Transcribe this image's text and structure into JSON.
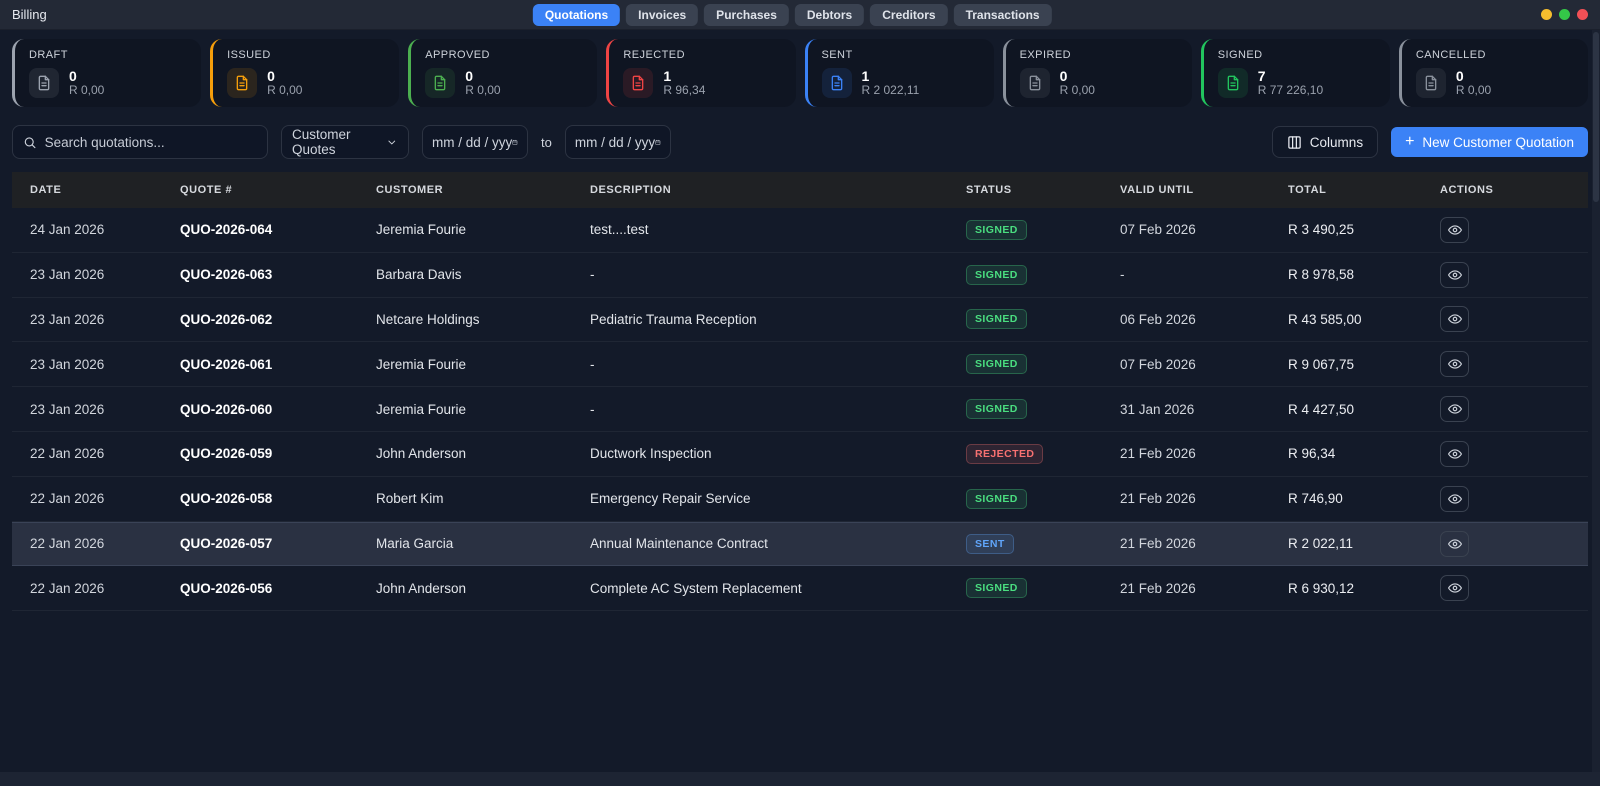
{
  "app": {
    "title": "Billing",
    "window_buttons": [
      {
        "name": "window-button-minimize",
        "color": "#f5bd2e"
      },
      {
        "name": "window-button-maximize",
        "color": "#34c748"
      },
      {
        "name": "window-button-close",
        "color": "#f25056"
      }
    ]
  },
  "colors": {
    "accent": "#3b82f6",
    "status": {
      "SIGNED": "#4ade80",
      "REJECTED": "#f87171",
      "SENT": "#60a5fa"
    }
  },
  "tabs": [
    {
      "label": "Quotations",
      "active": true
    },
    {
      "label": "Invoices",
      "active": false
    },
    {
      "label": "Purchases",
      "active": false
    },
    {
      "label": "Debtors",
      "active": false
    },
    {
      "label": "Creditors",
      "active": false
    },
    {
      "label": "Transactions",
      "active": false
    }
  ],
  "summary_cards": [
    {
      "label": "DRAFT",
      "count": "0",
      "amount": "R 0,00",
      "color": "#9ca3af"
    },
    {
      "label": "ISSUED",
      "count": "0",
      "amount": "R 0,00",
      "color": "#f59e0b"
    },
    {
      "label": "APPROVED",
      "count": "0",
      "amount": "R 0,00",
      "color": "#4caf50"
    },
    {
      "label": "REJECTED",
      "count": "1",
      "amount": "R 96,34",
      "color": "#ef4444"
    },
    {
      "label": "SENT",
      "count": "1",
      "amount": "R 2 022,11",
      "color": "#3b82f6"
    },
    {
      "label": "EXPIRED",
      "count": "0",
      "amount": "R 0,00",
      "color": "#8a919c"
    },
    {
      "label": "SIGNED",
      "count": "7",
      "amount": "R 77 226,10",
      "color": "#22c55e"
    },
    {
      "label": "CANCELLED",
      "count": "0",
      "amount": "R 0,00",
      "color": "#8a919c"
    }
  ],
  "filters": {
    "search_placeholder": "Search quotations...",
    "type_select_value": "Customer Quotes",
    "date_from_value": "mm / dd / yyy",
    "to_label": "to",
    "date_to_value": "mm / dd / yyy",
    "columns_button_label": "Columns",
    "new_button_label": "New Customer Quotation"
  },
  "table": {
    "headers": [
      "DATE",
      "QUOTE #",
      "CUSTOMER",
      "DESCRIPTION",
      "STATUS",
      "VALID UNTIL",
      "TOTAL",
      "ACTIONS"
    ],
    "rows": [
      {
        "date": "24 Jan 2026",
        "quote": "QUO-2026-064",
        "customer": "Jeremia Fourie",
        "description": "test....test",
        "status": "SIGNED",
        "valid_until": "07 Feb 2026",
        "total": "R 3 490,25",
        "highlighted": false
      },
      {
        "date": "23 Jan 2026",
        "quote": "QUO-2026-063",
        "customer": "Barbara Davis",
        "description": "-",
        "status": "SIGNED",
        "valid_until": "-",
        "total": "R 8 978,58",
        "highlighted": false
      },
      {
        "date": "23 Jan 2026",
        "quote": "QUO-2026-062",
        "customer": "Netcare Holdings",
        "description": "Pediatric Trauma Reception",
        "status": "SIGNED",
        "valid_until": "06 Feb 2026",
        "total": "R 43 585,00",
        "highlighted": false
      },
      {
        "date": "23 Jan 2026",
        "quote": "QUO-2026-061",
        "customer": "Jeremia Fourie",
        "description": "-",
        "status": "SIGNED",
        "valid_until": "07 Feb 2026",
        "total": "R 9 067,75",
        "highlighted": false
      },
      {
        "date": "23 Jan 2026",
        "quote": "QUO-2026-060",
        "customer": "Jeremia Fourie",
        "description": "-",
        "status": "SIGNED",
        "valid_until": "31 Jan 2026",
        "total": "R 4 427,50",
        "highlighted": false
      },
      {
        "date": "22 Jan 2026",
        "quote": "QUO-2026-059",
        "customer": "John Anderson",
        "description": "Ductwork Inspection",
        "status": "REJECTED",
        "valid_until": "21 Feb 2026",
        "total": "R 96,34",
        "highlighted": false
      },
      {
        "date": "22 Jan 2026",
        "quote": "QUO-2026-058",
        "customer": "Robert Kim",
        "description": "Emergency Repair Service",
        "status": "SIGNED",
        "valid_until": "21 Feb 2026",
        "total": "R 746,90",
        "highlighted": false
      },
      {
        "date": "22 Jan 2026",
        "quote": "QUO-2026-057",
        "customer": "Maria Garcia",
        "description": "Annual Maintenance Contract",
        "status": "SENT",
        "valid_until": "21 Feb 2026",
        "total": "R 2 022,11",
        "highlighted": true
      },
      {
        "date": "22 Jan 2026",
        "quote": "QUO-2026-056",
        "customer": "John Anderson",
        "description": "Complete AC System Replacement",
        "status": "SIGNED",
        "valid_until": "21 Feb 2026",
        "total": "R 6 930,12",
        "highlighted": false
      }
    ]
  }
}
